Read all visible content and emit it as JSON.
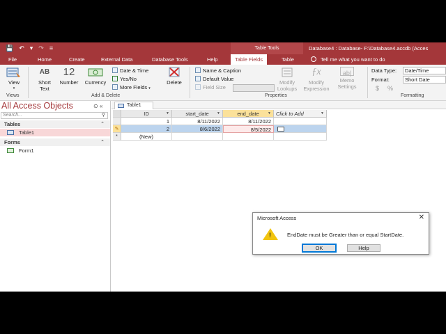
{
  "titlebar": {
    "qat": {
      "save": "💾",
      "undo": "↶",
      "undo_dd": "▾",
      "redo": "↷",
      "customize": "≡"
    },
    "context_title": "Table Tools",
    "doc_title": "Database4 : Database- F:\\Database4.accdb (Acces"
  },
  "tabs": {
    "file": "File",
    "home": "Home",
    "create": "Create",
    "external": "External Data",
    "dbtools": "Database Tools",
    "help": "Help",
    "table_fields": "Table Fields",
    "table": "Table",
    "tell_me": "Tell me what you want to do"
  },
  "ribbon": {
    "views": {
      "view": "View",
      "group": "Views"
    },
    "add_delete": {
      "short_text": "Short Text",
      "short_text_icon": "AB",
      "number": "Number",
      "number_icon": "12",
      "currency": "Currency",
      "date_time": "Date & Time",
      "yes_no": "Yes/No",
      "more_fields": "More Fields",
      "delete": "Delete",
      "group": "Add & Delete"
    },
    "properties": {
      "name_caption": "Name & Caption",
      "default_value": "Default Value",
      "field_size": "Field Size",
      "modify_lookups": "Modify Lookups",
      "modify_expression": "Modify Expression",
      "memo_settings": "Memo Settings",
      "group": "Properties"
    },
    "formatting": {
      "data_type_label": "Data Type:",
      "data_type_value": "Date/Time",
      "format_label": "Format:",
      "format_value": "Short Date",
      "currency_sym": "$",
      "percent_sym": "%",
      "group": "Formatting"
    }
  },
  "nav": {
    "title": "All Access Objects",
    "search_placeholder": "Search...",
    "tables_header": "Tables",
    "tables": [
      "Table1"
    ],
    "forms_header": "Forms",
    "forms": [
      "Form1"
    ]
  },
  "doc_tab": "Table1",
  "datasheet": {
    "columns": [
      "ID",
      "start_date",
      "end_date",
      "Click to Add"
    ],
    "rows": [
      {
        "id": "1",
        "start": "8/11/2022",
        "end": "8/11/2022"
      },
      {
        "id": "2",
        "start": "8/6/2022",
        "end": "8/5/2022"
      }
    ],
    "new_row_marker": "*",
    "new_row_label": "(New)",
    "edit_marker": "✎"
  },
  "dialog": {
    "title": "Microsoft Access",
    "message": "EndDate must be Greater than or equal StartDate.",
    "ok": "OK",
    "help": "Help",
    "close": "✕",
    "warn_mark": "!"
  }
}
